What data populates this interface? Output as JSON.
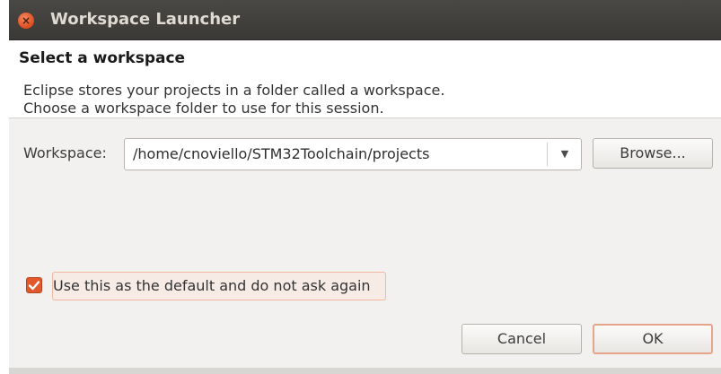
{
  "window": {
    "title": "Workspace Launcher",
    "close_glyph": "×"
  },
  "header": {
    "title": "Select a workspace"
  },
  "message": {
    "line1": "Eclipse stores your projects in a folder called a workspace.",
    "line2": "Choose a workspace folder to use for this session."
  },
  "workspace": {
    "label": "Workspace:",
    "value": "/home/cnoviello/STM32Toolchain/projects",
    "dropdown_glyph": "▼",
    "browse_label": "Browse..."
  },
  "default_option": {
    "checked": true,
    "check_glyph": "✓",
    "label": "Use this as the default and do not ask again"
  },
  "actions": {
    "cancel_label": "Cancel",
    "ok_label": "OK"
  },
  "colors": {
    "titlebar": "#3c3b37",
    "accent": "#e0582b",
    "dialog_bg": "#f2f1f0"
  }
}
